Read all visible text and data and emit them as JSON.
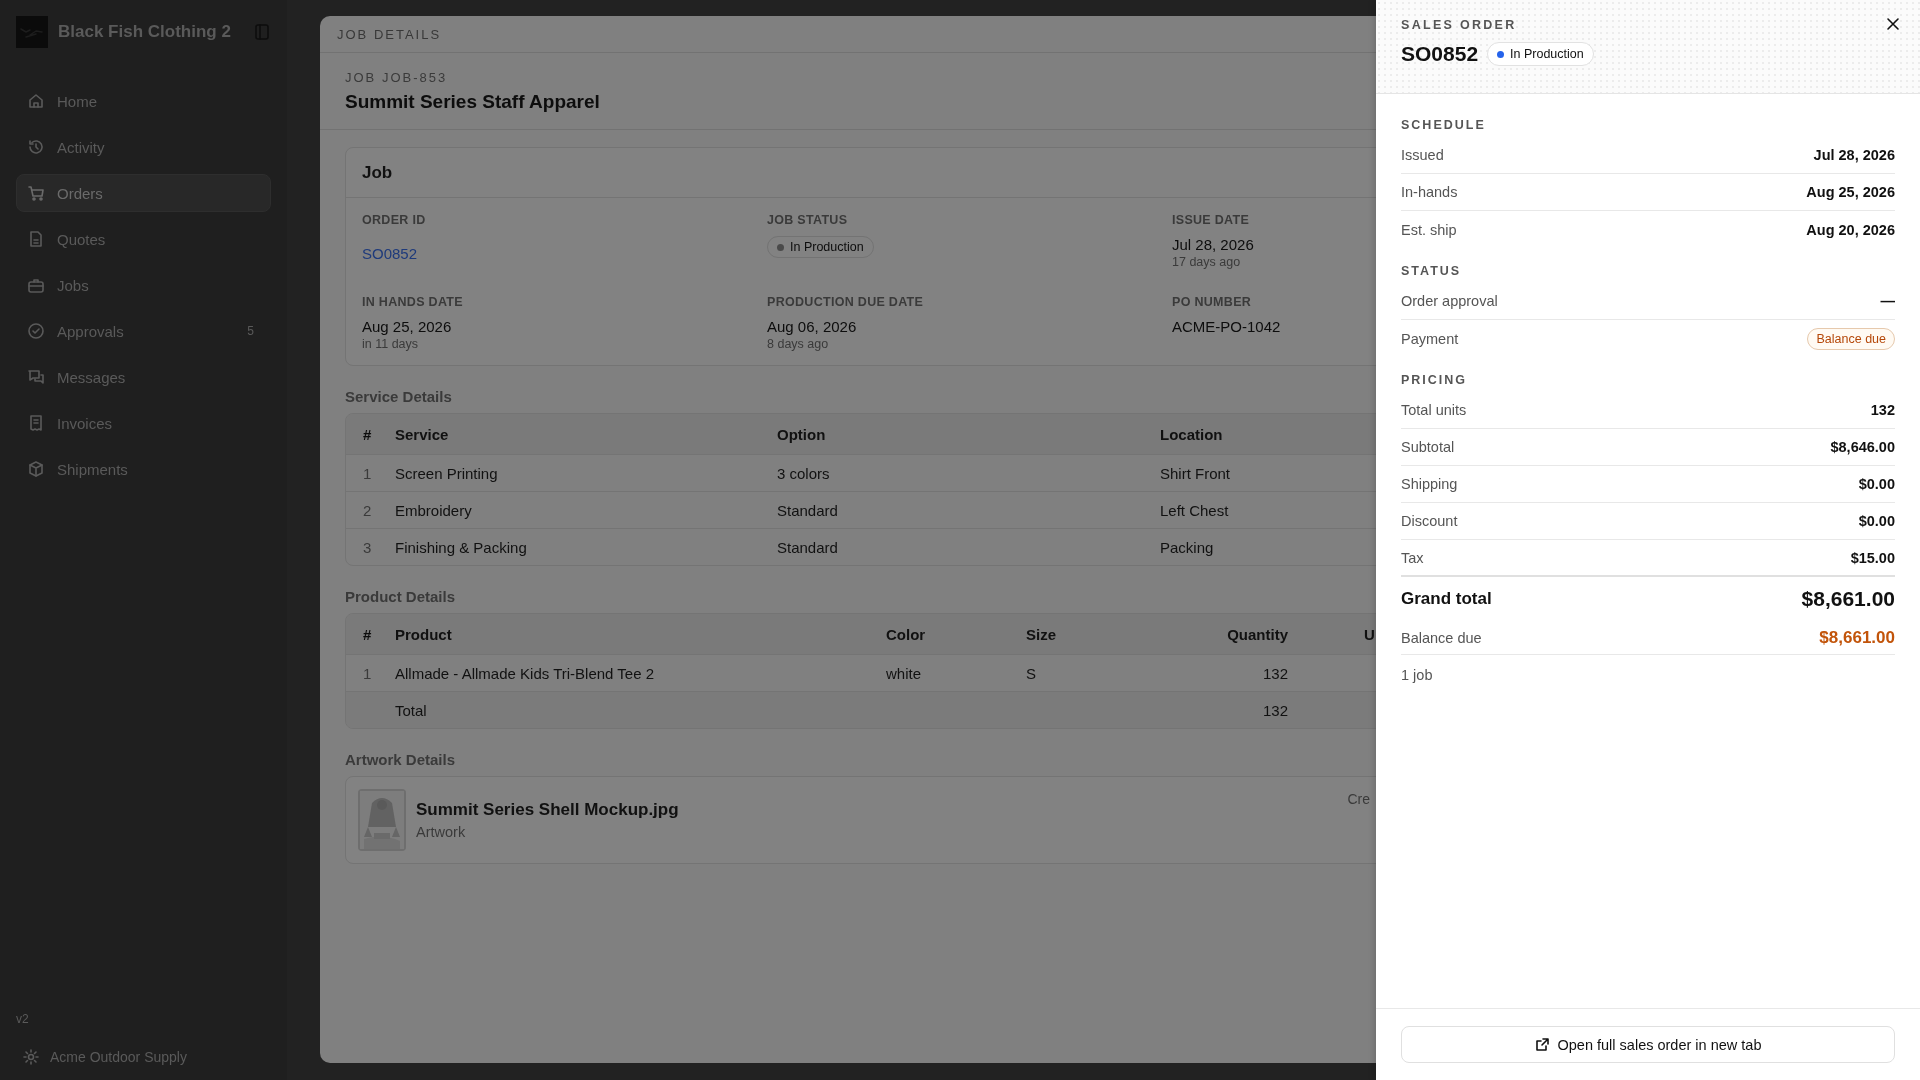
{
  "sidebar": {
    "brand": "Black Fish Clothing 2",
    "items": [
      {
        "label": "Home",
        "selected": false
      },
      {
        "label": "Activity",
        "selected": false
      },
      {
        "label": "Orders",
        "selected": true
      },
      {
        "label": "Quotes",
        "selected": false
      },
      {
        "label": "Jobs",
        "selected": false
      },
      {
        "label": "Approvals",
        "selected": false,
        "badge": "5"
      },
      {
        "label": "Messages",
        "selected": false
      },
      {
        "label": "Invoices",
        "selected": false
      },
      {
        "label": "Shipments",
        "selected": false
      }
    ],
    "version": "v2",
    "account": "Acme Outdoor Supply"
  },
  "modal": {
    "title": "JOB DETAILS",
    "subtitle": "JOB JOB-853",
    "heading": "Summit Series Staff Apparel",
    "job_card": {
      "title": "Job",
      "fields": [
        {
          "label": "ORDER ID",
          "kind": "link",
          "value": "SO0852"
        },
        {
          "label": "JOB STATUS",
          "kind": "status",
          "value": "In Production",
          "color": "#4a4a4a"
        },
        {
          "label": "ISSUE DATE",
          "kind": "text",
          "value": "Jul 28, 2026",
          "note": "17 days ago"
        },
        {
          "label": "IN HANDS DATE",
          "kind": "text",
          "value": "Aug 25, 2026",
          "note": "in 11 days"
        },
        {
          "label": "PRODUCTION DUE DATE",
          "kind": "text",
          "value": "Aug 06, 2026",
          "note": "8 days ago"
        },
        {
          "label": "PO NUMBER",
          "kind": "text",
          "value": "ACME-PO-1042"
        }
      ]
    },
    "service_details": {
      "title": "Service Details",
      "columns": [
        "#",
        "Service",
        "Option",
        "Location"
      ],
      "rows": [
        [
          "1",
          "Screen Printing",
          "3 colors",
          "Shirt Front"
        ],
        [
          "2",
          "Embroidery",
          "Standard",
          "Left Chest"
        ],
        [
          "3",
          "Finishing & Packing",
          "Standard",
          "Packing"
        ]
      ]
    },
    "product_details": {
      "title": "Product Details",
      "columns": [
        "#",
        "Product",
        "Color",
        "Size",
        "Quantity",
        "U"
      ],
      "rows": [
        [
          "1",
          "Allmade - Allmade Kids Tri-Blend Tee 2",
          "white",
          "S",
          "132"
        ]
      ],
      "total": {
        "label": "Total",
        "quantity": "132"
      }
    },
    "artwork_details": {
      "title": "Artwork Details",
      "items": [
        {
          "kind": "picture",
          "name": "Summit Series Shell Mockup.jpg",
          "type": "Artwork",
          "meta": "Cre"
        }
      ]
    }
  },
  "drawer": {
    "eyebrow": "SALES ORDER",
    "order_id": "SO0852",
    "status": {
      "label": "In Production",
      "color": "#2563eb"
    },
    "sections": [
      {
        "title": "SCHEDULE",
        "rows": [
          {
            "label": "Issued",
            "kind": "text",
            "value": "Jul 28, 2026"
          },
          {
            "label": "In-hands",
            "kind": "text",
            "value": "Aug 25, 2026"
          },
          {
            "label": "Est. ship",
            "kind": "text",
            "value": "Aug 20, 2026"
          }
        ]
      },
      {
        "title": "STATUS",
        "rows": [
          {
            "label": "Order approval",
            "kind": "text",
            "value": "—"
          },
          {
            "label": "Payment",
            "kind": "badge",
            "value": "Balance due"
          }
        ]
      },
      {
        "title": "PRICING",
        "rows": [
          {
            "label": "Total units",
            "kind": "text",
            "value": "132"
          },
          {
            "label": "Subtotal",
            "kind": "text",
            "value": "$8,646.00"
          },
          {
            "label": "Shipping",
            "kind": "text",
            "value": "$0.00"
          },
          {
            "label": "Discount",
            "kind": "text",
            "value": "$0.00"
          },
          {
            "label": "Tax",
            "kind": "text",
            "value": "$15.00"
          }
        ]
      }
    ],
    "grand_total": {
      "label": "Grand total",
      "value": "$8,661.00"
    },
    "balance_due": {
      "label": "Balance due",
      "value": "$8,661.00"
    },
    "jobs_count": "1 job",
    "footer_button": "Open full sales order in new tab"
  }
}
